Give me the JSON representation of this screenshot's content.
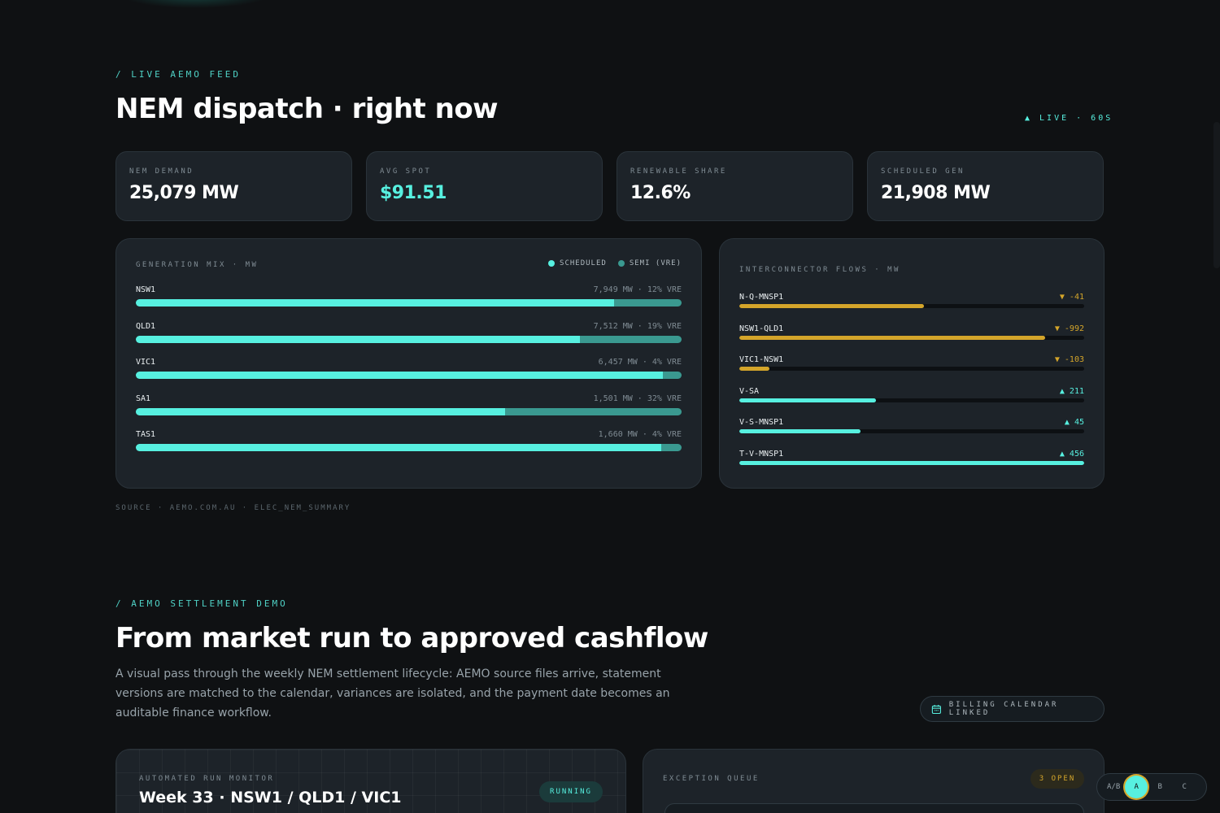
{
  "live_section": {
    "eyebrow": "/ LIVE AEMO FEED",
    "title": "NEM dispatch · right now",
    "live_badge": "▲ LIVE · 60S",
    "kpis": [
      {
        "label": "NEM DEMAND",
        "value": "25,079 MW"
      },
      {
        "label": "AVG SPOT",
        "value": "$91.51"
      },
      {
        "label": "RENEWABLE SHARE",
        "value": "12.6%"
      },
      {
        "label": "SCHEDULED GEN",
        "value": "21,908 MW"
      }
    ],
    "generation_mix": {
      "title": "GENERATION MIX · MW",
      "legend": [
        "SCHEDULED",
        "SEMI (VRE)"
      ],
      "rows": [
        {
          "region": "NSW1",
          "stat": "7,949 MW · 12% VRE",
          "scheduled_fraction": 0.876
        },
        {
          "region": "QLD1",
          "stat": "7,512 MW · 19% VRE",
          "scheduled_fraction": 0.813
        },
        {
          "region": "VIC1",
          "stat": "6,457 MW · 4% VRE",
          "scheduled_fraction": 0.966
        },
        {
          "region": "SA1",
          "stat": "1,501 MW · 32% VRE",
          "scheduled_fraction": 0.677
        },
        {
          "region": "TAS1",
          "stat": "1,660 MW · 4% VRE",
          "scheduled_fraction": 0.962
        }
      ]
    },
    "interconnectors": {
      "title": "INTERCONNECTOR FLOWS · MW",
      "rows": [
        {
          "name": "N-Q-MNSP1",
          "flow": "▼ -41",
          "direction": "down",
          "level": 0.535
        },
        {
          "name": "NSW1-QLD1",
          "flow": "▼ -992",
          "direction": "down",
          "level": 0.887
        },
        {
          "name": "VIC1-NSW1",
          "flow": "▼ -103",
          "direction": "down",
          "level": 0.087
        },
        {
          "name": "V-SA",
          "flow": "▲ 211",
          "direction": "up",
          "level": 0.396
        },
        {
          "name": "V-S-MNSP1",
          "flow": "▲ 45",
          "direction": "up",
          "level": 0.351
        },
        {
          "name": "T-V-MNSP1",
          "flow": "▲ 456",
          "direction": "up",
          "level": 1.0
        }
      ]
    },
    "source": "SOURCE · AEMO.COM.AU · ELEC_NEM_SUMMARY"
  },
  "settlement_section": {
    "eyebrow": "/ AEMO SETTLEMENT DEMO",
    "title": "From market run to approved cashflow",
    "description": "A visual pass through the weekly NEM settlement lifecycle: AEMO source files arrive, statement versions are matched to the calendar, variances are isolated, and the payment date becomes an auditable finance workflow.",
    "calendar_button": "BILLING CALENDAR LINKED",
    "run_monitor": {
      "label": "AUTOMATED RUN MONITOR",
      "week": "Week 33 · NSW1 / QLD1 / VIC1",
      "status": "RUNNING"
    },
    "exception_queue": {
      "label": "EXCEPTION QUEUE",
      "badge": "3 OPEN"
    }
  },
  "ab_switch": {
    "label": "A/B",
    "options": [
      "A",
      "B",
      "C"
    ],
    "active": "A"
  },
  "colors": {
    "accent": "#57f0e0",
    "vre": "#3a9990",
    "warning": "#d4a52a",
    "panel": "#1d2329"
  }
}
